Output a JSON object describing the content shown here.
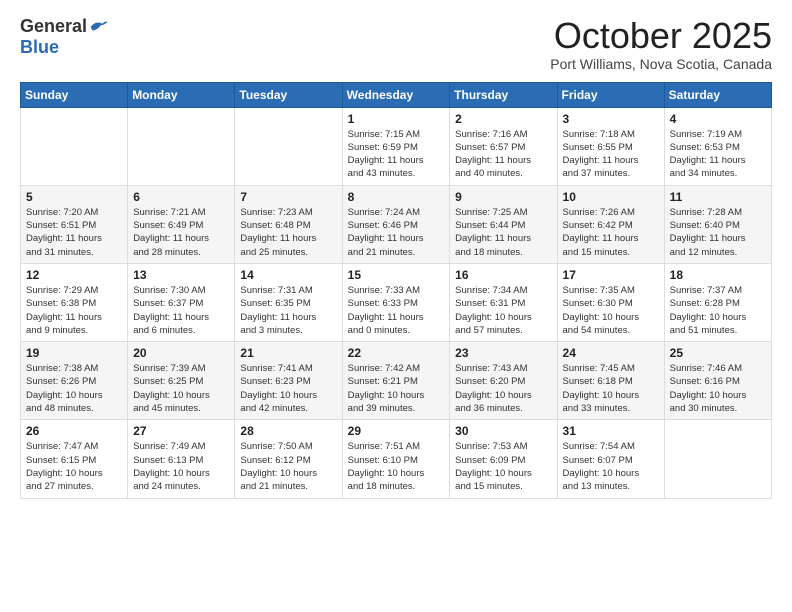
{
  "header": {
    "logo_general": "General",
    "logo_blue": "Blue",
    "title": "October 2025",
    "location": "Port Williams, Nova Scotia, Canada"
  },
  "days_of_week": [
    "Sunday",
    "Monday",
    "Tuesday",
    "Wednesday",
    "Thursday",
    "Friday",
    "Saturday"
  ],
  "weeks": [
    [
      {
        "day": "",
        "info": ""
      },
      {
        "day": "",
        "info": ""
      },
      {
        "day": "",
        "info": ""
      },
      {
        "day": "1",
        "info": "Sunrise: 7:15 AM\nSunset: 6:59 PM\nDaylight: 11 hours\nand 43 minutes."
      },
      {
        "day": "2",
        "info": "Sunrise: 7:16 AM\nSunset: 6:57 PM\nDaylight: 11 hours\nand 40 minutes."
      },
      {
        "day": "3",
        "info": "Sunrise: 7:18 AM\nSunset: 6:55 PM\nDaylight: 11 hours\nand 37 minutes."
      },
      {
        "day": "4",
        "info": "Sunrise: 7:19 AM\nSunset: 6:53 PM\nDaylight: 11 hours\nand 34 minutes."
      }
    ],
    [
      {
        "day": "5",
        "info": "Sunrise: 7:20 AM\nSunset: 6:51 PM\nDaylight: 11 hours\nand 31 minutes."
      },
      {
        "day": "6",
        "info": "Sunrise: 7:21 AM\nSunset: 6:49 PM\nDaylight: 11 hours\nand 28 minutes."
      },
      {
        "day": "7",
        "info": "Sunrise: 7:23 AM\nSunset: 6:48 PM\nDaylight: 11 hours\nand 25 minutes."
      },
      {
        "day": "8",
        "info": "Sunrise: 7:24 AM\nSunset: 6:46 PM\nDaylight: 11 hours\nand 21 minutes."
      },
      {
        "day": "9",
        "info": "Sunrise: 7:25 AM\nSunset: 6:44 PM\nDaylight: 11 hours\nand 18 minutes."
      },
      {
        "day": "10",
        "info": "Sunrise: 7:26 AM\nSunset: 6:42 PM\nDaylight: 11 hours\nand 15 minutes."
      },
      {
        "day": "11",
        "info": "Sunrise: 7:28 AM\nSunset: 6:40 PM\nDaylight: 11 hours\nand 12 minutes."
      }
    ],
    [
      {
        "day": "12",
        "info": "Sunrise: 7:29 AM\nSunset: 6:38 PM\nDaylight: 11 hours\nand 9 minutes."
      },
      {
        "day": "13",
        "info": "Sunrise: 7:30 AM\nSunset: 6:37 PM\nDaylight: 11 hours\nand 6 minutes."
      },
      {
        "day": "14",
        "info": "Sunrise: 7:31 AM\nSunset: 6:35 PM\nDaylight: 11 hours\nand 3 minutes."
      },
      {
        "day": "15",
        "info": "Sunrise: 7:33 AM\nSunset: 6:33 PM\nDaylight: 11 hours\nand 0 minutes."
      },
      {
        "day": "16",
        "info": "Sunrise: 7:34 AM\nSunset: 6:31 PM\nDaylight: 10 hours\nand 57 minutes."
      },
      {
        "day": "17",
        "info": "Sunrise: 7:35 AM\nSunset: 6:30 PM\nDaylight: 10 hours\nand 54 minutes."
      },
      {
        "day": "18",
        "info": "Sunrise: 7:37 AM\nSunset: 6:28 PM\nDaylight: 10 hours\nand 51 minutes."
      }
    ],
    [
      {
        "day": "19",
        "info": "Sunrise: 7:38 AM\nSunset: 6:26 PM\nDaylight: 10 hours\nand 48 minutes."
      },
      {
        "day": "20",
        "info": "Sunrise: 7:39 AM\nSunset: 6:25 PM\nDaylight: 10 hours\nand 45 minutes."
      },
      {
        "day": "21",
        "info": "Sunrise: 7:41 AM\nSunset: 6:23 PM\nDaylight: 10 hours\nand 42 minutes."
      },
      {
        "day": "22",
        "info": "Sunrise: 7:42 AM\nSunset: 6:21 PM\nDaylight: 10 hours\nand 39 minutes."
      },
      {
        "day": "23",
        "info": "Sunrise: 7:43 AM\nSunset: 6:20 PM\nDaylight: 10 hours\nand 36 minutes."
      },
      {
        "day": "24",
        "info": "Sunrise: 7:45 AM\nSunset: 6:18 PM\nDaylight: 10 hours\nand 33 minutes."
      },
      {
        "day": "25",
        "info": "Sunrise: 7:46 AM\nSunset: 6:16 PM\nDaylight: 10 hours\nand 30 minutes."
      }
    ],
    [
      {
        "day": "26",
        "info": "Sunrise: 7:47 AM\nSunset: 6:15 PM\nDaylight: 10 hours\nand 27 minutes."
      },
      {
        "day": "27",
        "info": "Sunrise: 7:49 AM\nSunset: 6:13 PM\nDaylight: 10 hours\nand 24 minutes."
      },
      {
        "day": "28",
        "info": "Sunrise: 7:50 AM\nSunset: 6:12 PM\nDaylight: 10 hours\nand 21 minutes."
      },
      {
        "day": "29",
        "info": "Sunrise: 7:51 AM\nSunset: 6:10 PM\nDaylight: 10 hours\nand 18 minutes."
      },
      {
        "day": "30",
        "info": "Sunrise: 7:53 AM\nSunset: 6:09 PM\nDaylight: 10 hours\nand 15 minutes."
      },
      {
        "day": "31",
        "info": "Sunrise: 7:54 AM\nSunset: 6:07 PM\nDaylight: 10 hours\nand 13 minutes."
      },
      {
        "day": "",
        "info": ""
      }
    ]
  ]
}
